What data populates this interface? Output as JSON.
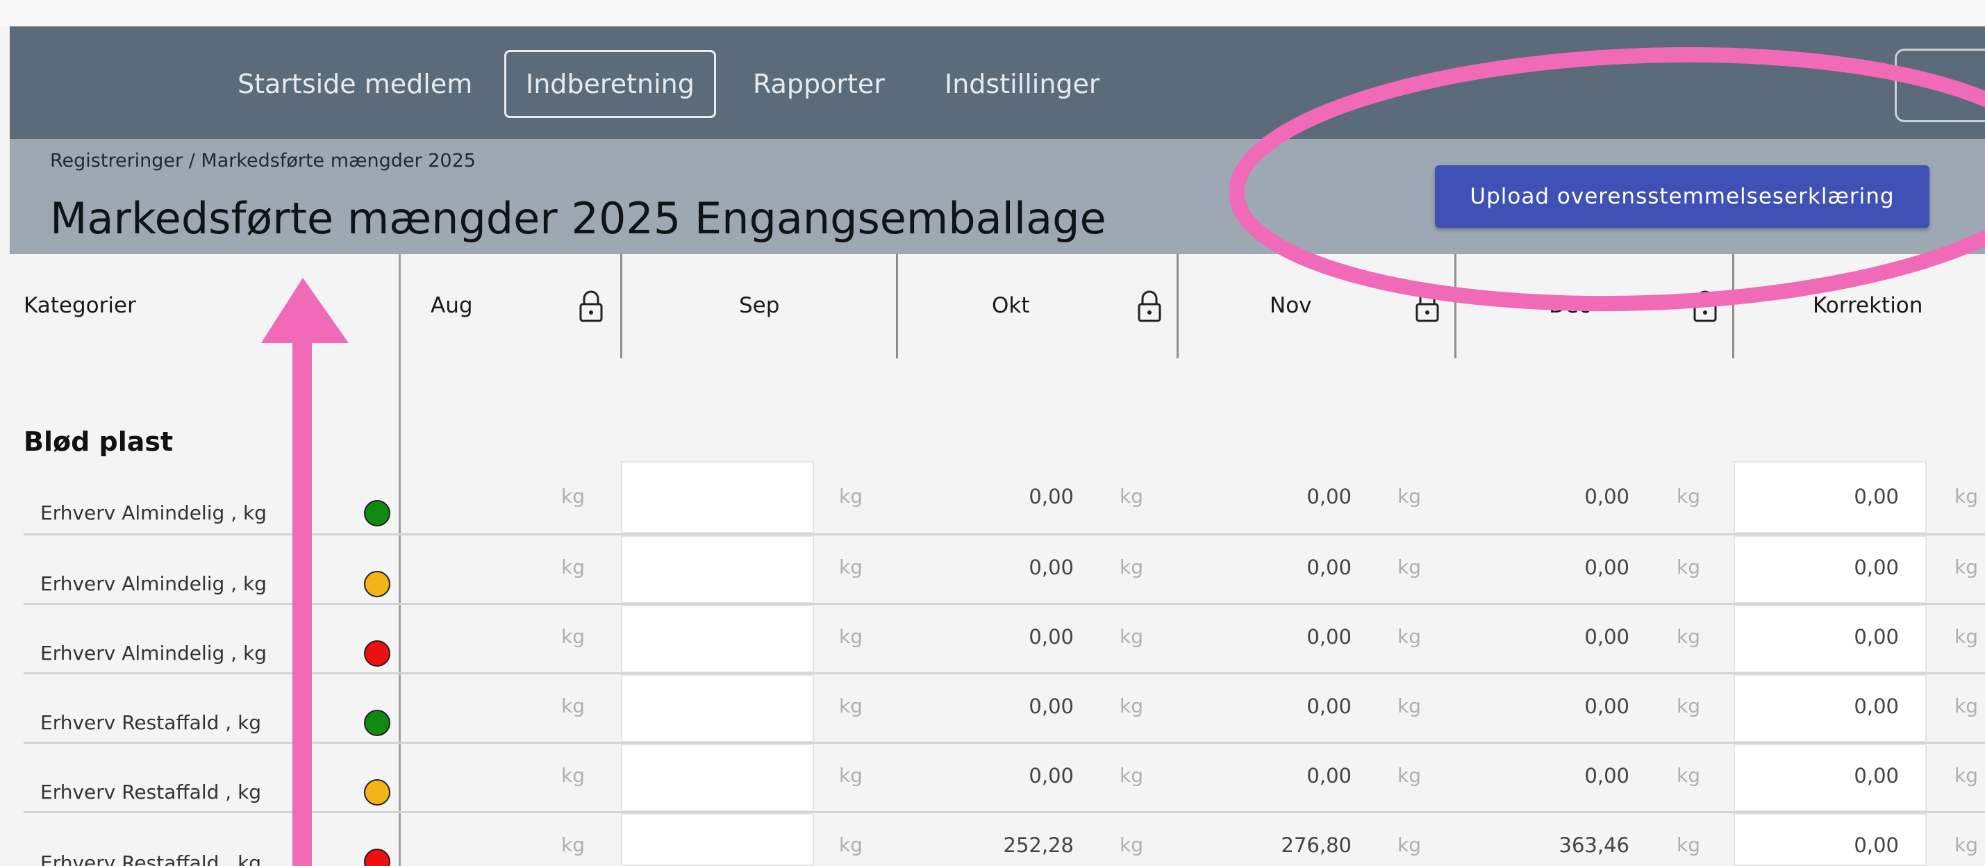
{
  "nav": {
    "items": [
      "Startside medlem",
      "Indberetning",
      "Rapporter",
      "Indstillinger"
    ],
    "active_index": 1
  },
  "breadcrumb": "Registreringer / Markedsførte mængder 2025",
  "page_title": "Markedsførte mængder 2025 Engangsemballage",
  "upload_button": "Upload overensstemmelseserklæring",
  "table": {
    "category_header": "Kategorier",
    "columns": [
      "Aug",
      "Sep",
      "Okt",
      "Nov",
      "Dec",
      "Korrektion"
    ],
    "locked_columns": [
      "Aug",
      "Okt",
      "Nov",
      "Dec"
    ],
    "unit": "kg",
    "section": "Blød plast",
    "rows": [
      {
        "label": "Erhverv Almindelig , kg",
        "status": "green",
        "okt": "0,00",
        "nov": "0,00",
        "dec": "0,00",
        "korrektion": "0,00"
      },
      {
        "label": "Erhverv Almindelig , kg",
        "status": "yellow",
        "okt": "0,00",
        "nov": "0,00",
        "dec": "0,00",
        "korrektion": "0,00"
      },
      {
        "label": "Erhverv Almindelig , kg",
        "status": "red",
        "okt": "0,00",
        "nov": "0,00",
        "dec": "0,00",
        "korrektion": "0,00"
      },
      {
        "label": "Erhverv Restaffald , kg",
        "status": "green",
        "okt": "0,00",
        "nov": "0,00",
        "dec": "0,00",
        "korrektion": "0,00"
      },
      {
        "label": "Erhverv Restaffald , kg",
        "status": "yellow",
        "okt": "0,00",
        "nov": "0,00",
        "dec": "0,00",
        "korrektion": "0,00"
      },
      {
        "label": "Erhverv Restaffald , kg",
        "status": "red",
        "okt": "252,28",
        "nov": "276,80",
        "dec": "363,46",
        "korrektion": "0,00"
      }
    ]
  },
  "colors": {
    "navbar": "#5c6b7a",
    "subheader": "#9da8b3",
    "upload_button": "#3f51b5",
    "annotation": "#f06ab7",
    "status_green": "#108a10",
    "status_yellow": "#f2b416",
    "status_red": "#ee1010"
  },
  "annotations": [
    "pink-ellipse-around-upload-button",
    "pink-arrow-up-to-title"
  ]
}
